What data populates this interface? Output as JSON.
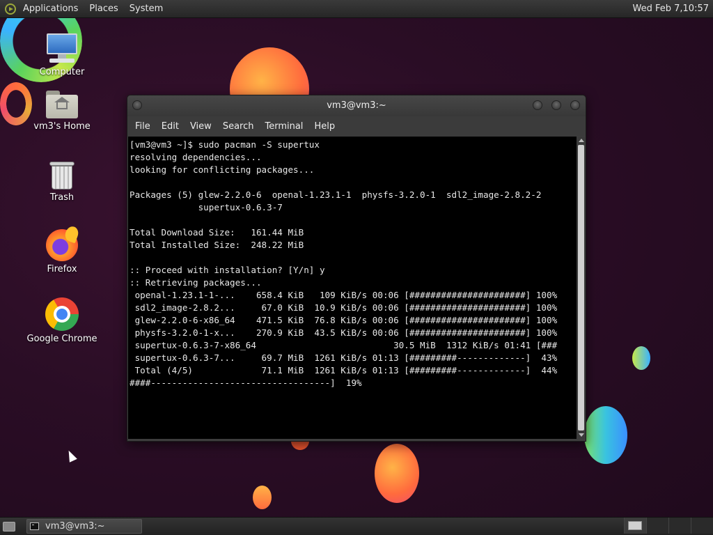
{
  "top_panel": {
    "menus": [
      "Applications",
      "Places",
      "System"
    ],
    "clock": "Wed Feb  7,10:57"
  },
  "desktop": {
    "icons": [
      {
        "label": "Computer",
        "icon": "computer-icon"
      },
      {
        "label": "vm3's Home",
        "icon": "home-folder-icon"
      },
      {
        "label": "Trash",
        "icon": "trash-icon"
      },
      {
        "label": "Firefox",
        "icon": "firefox-icon"
      },
      {
        "label": "Google Chrome",
        "icon": "chrome-icon"
      }
    ]
  },
  "window": {
    "title": "vm3@vm3:~",
    "menu": [
      "File",
      "Edit",
      "View",
      "Search",
      "Terminal",
      "Help"
    ],
    "terminal_lines": [
      "[vm3@vm3 ~]$ sudo pacman -S supertux",
      "resolving dependencies...",
      "looking for conflicting packages...",
      "",
      "Packages (5) glew-2.2.0-6  openal-1.23.1-1  physfs-3.2.0-1  sdl2_image-2.8.2-2",
      "             supertux-0.6.3-7",
      "",
      "Total Download Size:   161.44 MiB",
      "Total Installed Size:  248.22 MiB",
      "",
      ":: Proceed with installation? [Y/n] y",
      ":: Retrieving packages...",
      " openal-1.23.1-1-...    658.4 KiB   109 KiB/s 00:06 [######################] 100%",
      " sdl2_image-2.8.2...     67.0 KiB  10.9 KiB/s 00:06 [######################] 100%",
      " glew-2.2.0-6-x86_64    471.5 KiB  76.8 KiB/s 00:06 [######################] 100%",
      " physfs-3.2.0-1-x...    270.9 KiB  43.5 KiB/s 00:06 [######################] 100%",
      " supertux-0.6.3-7-x86_64                          30.5 MiB  1312 KiB/s 01:41 [###",
      " supertux-0.6.3-7...     69.7 MiB  1261 KiB/s 01:13 [#########-------------]  43%",
      " Total (4/5)             71.1 MiB  1261 KiB/s 01:13 [#########-------------]  44%",
      "####----------------------------------]  19%"
    ]
  },
  "taskbar": {
    "task_label": "vm3@vm3:~"
  }
}
